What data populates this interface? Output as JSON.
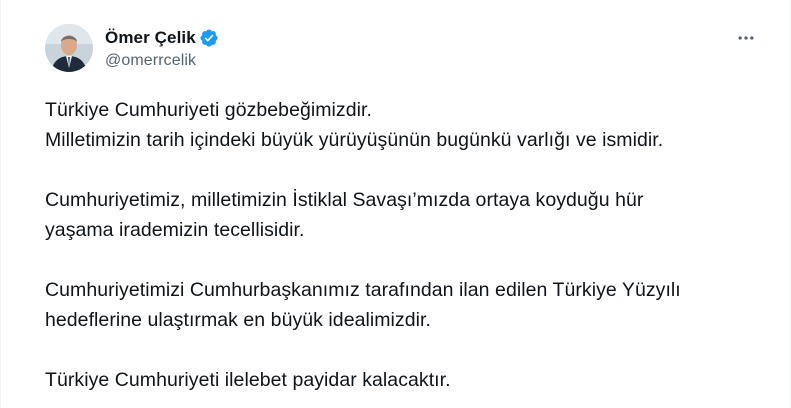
{
  "author": {
    "display_name": "Ömer Çelik",
    "handle": "@omerrcelik",
    "verified": true
  },
  "icons": {
    "verified": "verified-badge-icon",
    "more": "more-horizontal-icon"
  },
  "colors": {
    "verified_blue": "#1d9bf0",
    "text_primary": "#0f1419",
    "text_secondary": "#536471"
  },
  "tweet": {
    "paragraphs": [
      {
        "lines": [
          "Türkiye Cumhuriyeti gözbebeğimizdir.",
          "Milletimizin tarih içindeki büyük yürüyüşünün bugünkü varlığı ve ismidir."
        ]
      },
      {
        "lines": [
          "Cumhuriyetimiz, milletimizin İstiklal Savaşı’mızda ortaya koyduğu hür",
          "yaşama irademizin tecellisidir."
        ]
      },
      {
        "lines": [
          "Cumhuriyetimizi Cumhurbaşkanımız tarafından ilan edilen Türkiye Yüzyılı",
          "hedeflerine ulaştırmak en büyük idealimizdir."
        ]
      },
      {
        "lines": [
          "Türkiye Cumhuriyeti ilelebet payidar kalacaktır."
        ]
      }
    ]
  }
}
